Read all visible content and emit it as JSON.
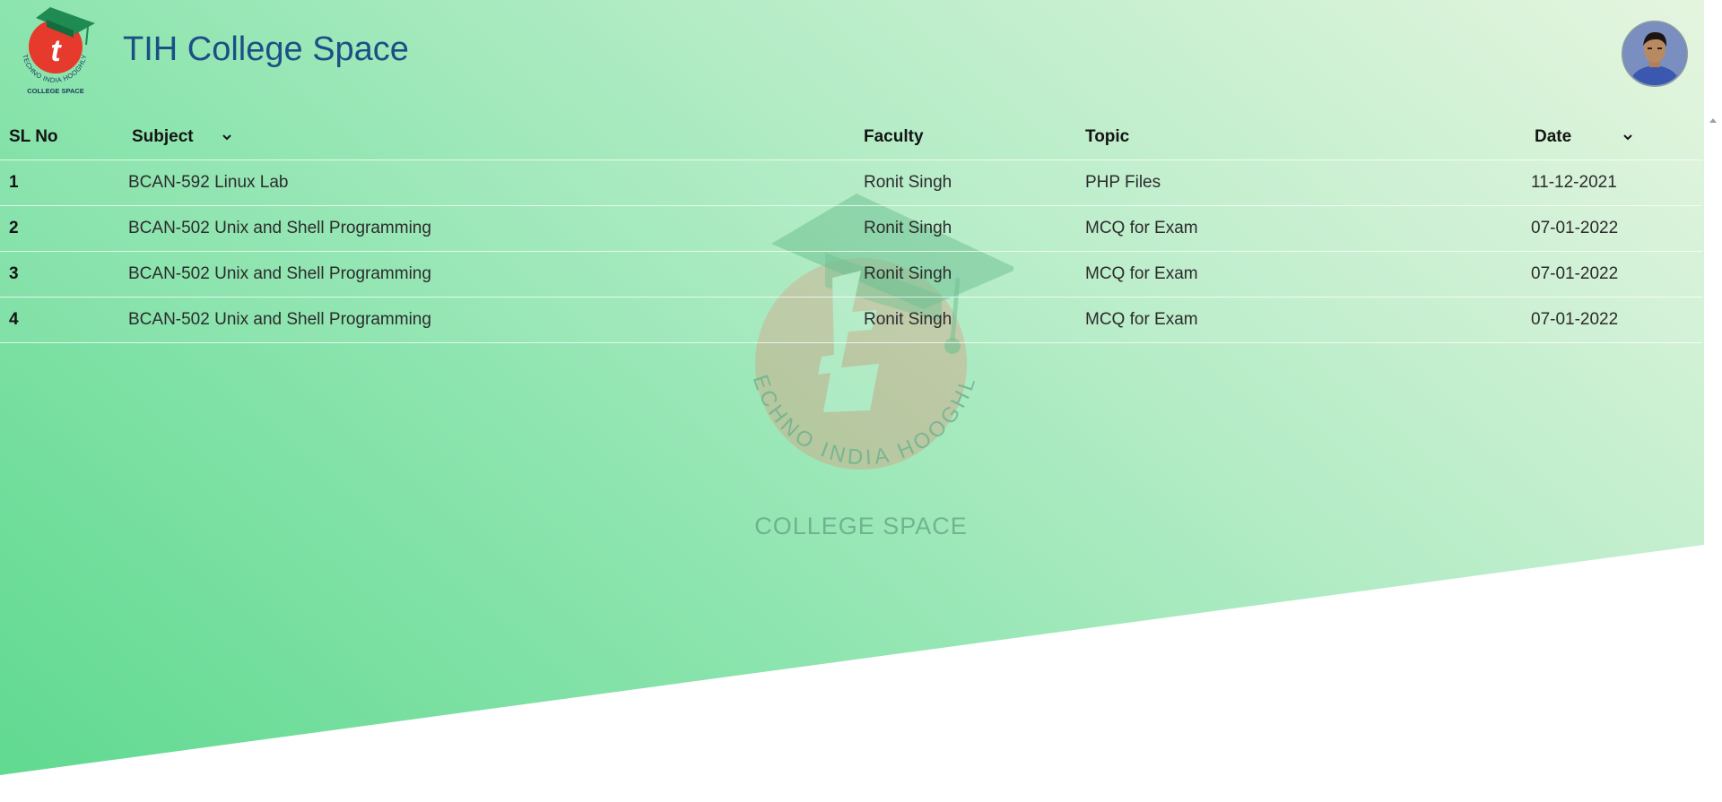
{
  "header": {
    "title": "TIH College Space",
    "logo": {
      "ring_text": "TECHNO INDIA HOOGHLY",
      "caption": "COLLEGE SPACE",
      "letter": "t"
    },
    "avatar_icon": "user-avatar"
  },
  "watermark": {
    "ring_text": "TECHNO INDIA HOOGHLY",
    "caption": "COLLEGE SPACE"
  },
  "table": {
    "columns": {
      "sl": "SL No",
      "subject": "Subject",
      "faculty": "Faculty",
      "topic": "Topic",
      "date": "Date"
    },
    "sort_icon": "chevron-down-icon",
    "rows": [
      {
        "sl": "1",
        "subject": "BCAN-592 Linux Lab",
        "faculty": "Ronit Singh",
        "topic": "PHP Files",
        "date": "11-12-2021"
      },
      {
        "sl": "2",
        "subject": "BCAN-502 Unix and Shell Programming",
        "faculty": "Ronit Singh",
        "topic": "MCQ for Exam",
        "date": "07-01-2022"
      },
      {
        "sl": "3",
        "subject": "BCAN-502 Unix and Shell Programming",
        "faculty": "Ronit Singh",
        "topic": "MCQ for Exam",
        "date": "07-01-2022"
      },
      {
        "sl": "4",
        "subject": "BCAN-502 Unix and Shell Programming",
        "faculty": "Ronit Singh",
        "topic": "MCQ for Exam",
        "date": "07-01-2022"
      }
    ]
  },
  "colors": {
    "title": "#1b4f86",
    "logo_red": "#e53a2c",
    "cap_green": "#1f8a52",
    "gradient_start": "#5fd990",
    "gradient_end": "#e5f5df"
  }
}
